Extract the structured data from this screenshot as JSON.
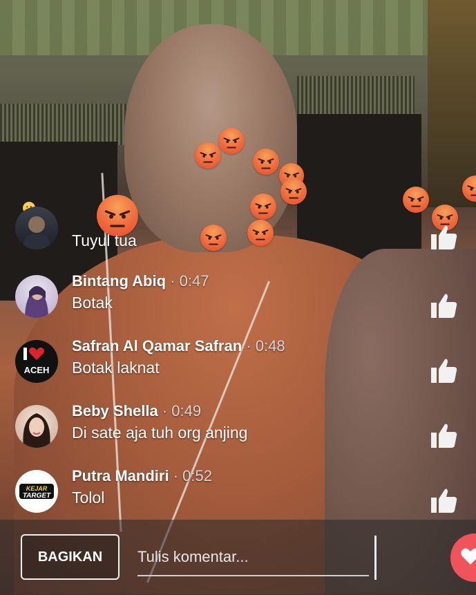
{
  "comments": [
    {
      "name": "",
      "time": "",
      "text": "Tuyul tua",
      "avatar": "dark-portrait"
    },
    {
      "name": "Bintang Abiq",
      "time": "· 0:47",
      "text": "Botak",
      "avatar": "hijab-portrait"
    },
    {
      "name": "Safran Al Qamar Safran",
      "time": "· 0:48",
      "text": "Botak laknat",
      "avatar": "i-love-aceh-logo"
    },
    {
      "name": "Beby Shella",
      "time": "· 0:49",
      "text": "Di sate aja tuh org anjing",
      "avatar": "woman-portrait"
    },
    {
      "name": "Putra Mandiri",
      "time": "· 0:52",
      "text": "Tolol",
      "avatar": "kejar-target-logo"
    }
  ],
  "avatar_logos": {
    "aceh_text": "ACEH",
    "kejar_text": "KEJAR",
    "target_text": "TARGET"
  },
  "bottom_bar": {
    "share_label": "BAGIKAN",
    "comment_placeholder": "Tulis komentar..."
  },
  "reactions": {
    "type": "angry-icon",
    "color": "#ef6a3c"
  },
  "colors": {
    "heart_button": "#f0535a",
    "comment_text": "#ffffff"
  }
}
